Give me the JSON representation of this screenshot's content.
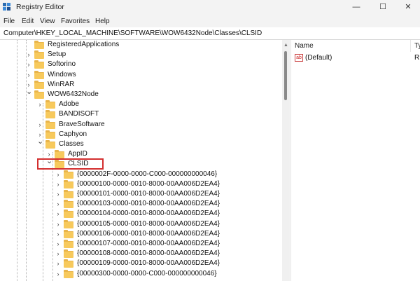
{
  "window": {
    "title": "Registry Editor",
    "controls": {
      "minimize": "—",
      "maximize": "☐",
      "close": "✕"
    }
  },
  "menu": [
    "File",
    "Edit",
    "View",
    "Favorites",
    "Help"
  ],
  "address": "Computer\\HKEY_LOCAL_MACHINE\\SOFTWARE\\WOW6432Node\\Classes\\CLSID",
  "tree": [
    {
      "label": "RegisteredApplications",
      "expander": "none",
      "level": 0
    },
    {
      "label": "Setup",
      "expander": "collapsed",
      "level": 0
    },
    {
      "label": "Softorino",
      "expander": "collapsed",
      "level": 0
    },
    {
      "label": "Windows",
      "expander": "collapsed",
      "level": 0
    },
    {
      "label": "WinRAR",
      "expander": "collapsed",
      "level": 0
    },
    {
      "label": "WOW6432Node",
      "expander": "expanded",
      "level": 0
    },
    {
      "label": "Adobe",
      "expander": "collapsed",
      "level": 1
    },
    {
      "label": "BANDISOFT",
      "expander": "none",
      "level": 1
    },
    {
      "label": "BraveSoftware",
      "expander": "collapsed",
      "level": 1
    },
    {
      "label": "Caphyon",
      "expander": "collapsed",
      "level": 1
    },
    {
      "label": "Classes",
      "expander": "expanded",
      "level": 1
    },
    {
      "label": "AppID",
      "expander": "collapsed",
      "level": 2
    },
    {
      "label": "CLSID",
      "expander": "expanded",
      "level": 2,
      "selected": true
    },
    {
      "label": "{0000002F-0000-0000-C000-000000000046}",
      "expander": "collapsed",
      "level": 3
    },
    {
      "label": "{00000100-0000-0010-8000-00AA006D2EA4}",
      "expander": "collapsed",
      "level": 3
    },
    {
      "label": "{00000101-0000-0010-8000-00AA006D2EA4}",
      "expander": "collapsed",
      "level": 3
    },
    {
      "label": "{00000103-0000-0010-8000-00AA006D2EA4}",
      "expander": "collapsed",
      "level": 3
    },
    {
      "label": "{00000104-0000-0010-8000-00AA006D2EA4}",
      "expander": "collapsed",
      "level": 3
    },
    {
      "label": "{00000105-0000-0010-8000-00AA006D2EA4}",
      "expander": "collapsed",
      "level": 3
    },
    {
      "label": "{00000106-0000-0010-8000-00AA006D2EA4}",
      "expander": "collapsed",
      "level": 3
    },
    {
      "label": "{00000107-0000-0010-8000-00AA006D2EA4}",
      "expander": "collapsed",
      "level": 3
    },
    {
      "label": "{00000108-0000-0010-8000-00AA006D2EA4}",
      "expander": "collapsed",
      "level": 3
    },
    {
      "label": "{00000109-0000-0010-8000-00AA006D2EA4}",
      "expander": "collapsed",
      "level": 3
    },
    {
      "label": "{00000300-0000-0000-C000-000000000046}",
      "expander": "collapsed",
      "level": 3
    }
  ],
  "values_pane": {
    "headers": {
      "name": "Name",
      "type": "Ty"
    },
    "rows": [
      {
        "icon": "ab",
        "name": "(Default)",
        "type": "R"
      }
    ]
  },
  "colors": {
    "highlight_box": "#d32f2f",
    "folder": "#f7c95c"
  }
}
